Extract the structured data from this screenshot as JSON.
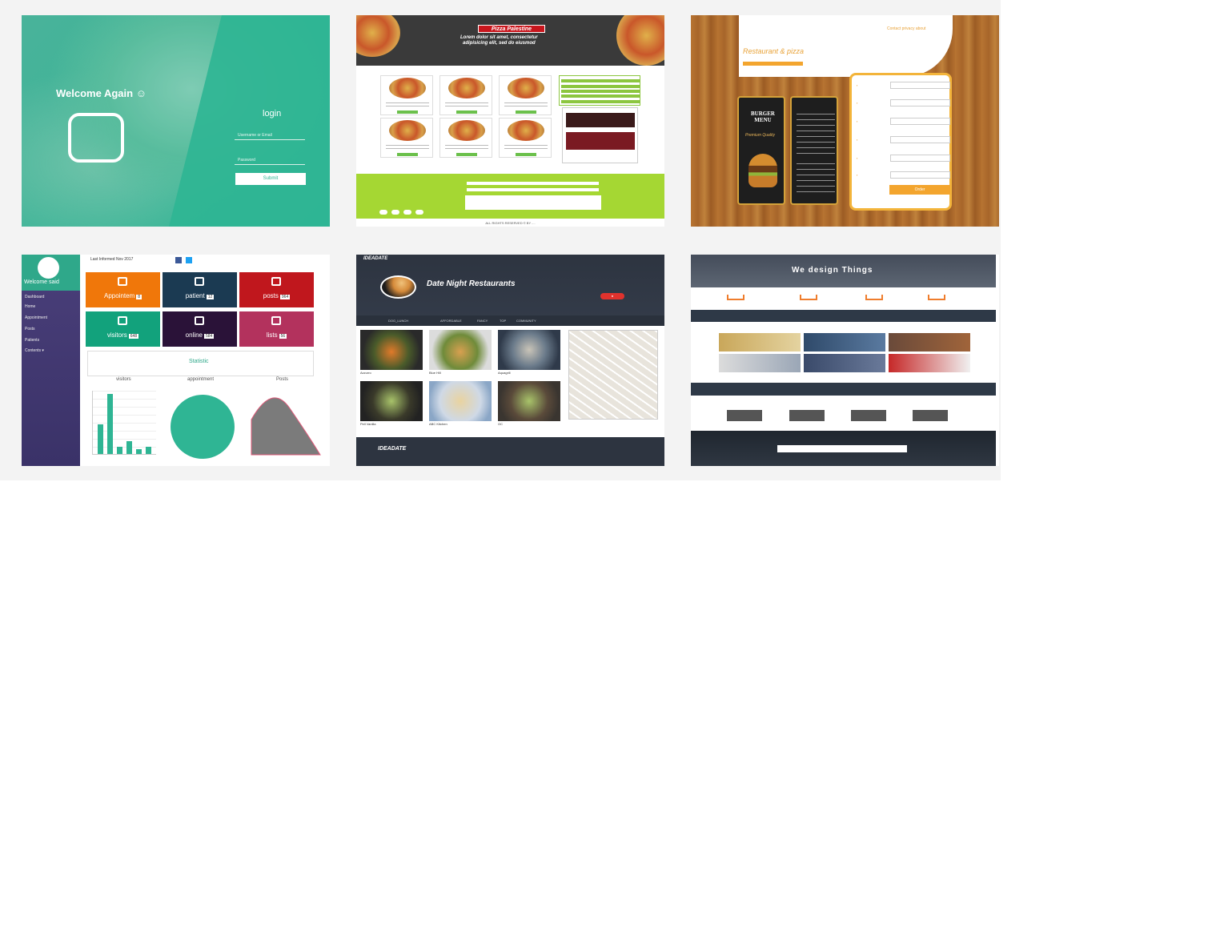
{
  "tile1": {
    "welcome": "Welcome Again ☺",
    "login_title": "login",
    "username_placeholder": "Username or Email",
    "password_placeholder": "Password",
    "submit_label": "Submit"
  },
  "tile2": {
    "title": "Pizza Palestine",
    "subtitle_line1": "Lorem dolor sit amet, consectetur",
    "subtitle_line2": "adipisicing elit, sed do eiusmod",
    "copyright": "ALL RIGHTS RESERVED © BY ...."
  },
  "tile3": {
    "brand": "Restaurant & pizza",
    "nav": "Contact   privacy   about",
    "menu_title": "BURGER MENU",
    "menu_subtitle": "Premium Quality",
    "order_label": "Order"
  },
  "tile4": {
    "welcome": "Welcome said",
    "date_text": "Last Informed Nov 2017",
    "sidebar": [
      "Dashboard",
      "Home",
      "Appointment",
      "Posts",
      "Patients",
      "Contents ▾"
    ],
    "cards": [
      {
        "label": "Appointem",
        "count": "8",
        "color": "#f0770a"
      },
      {
        "label": "patient",
        "count": "12",
        "color": "#1b3a52"
      },
      {
        "label": "posts",
        "count": "964",
        "color": "#c0171d"
      },
      {
        "label": "visitors",
        "count": "648",
        "color": "#12a27c"
      },
      {
        "label": "online",
        "count": "584",
        "color": "#2a1238"
      },
      {
        "label": "lists",
        "count": "56",
        "color": "#b3325d"
      }
    ],
    "statistic_label": "Statistic",
    "chart_titles": [
      "visitors",
      "appointment",
      "Posts"
    ],
    "bar_values": [
      12,
      24,
      3,
      5,
      2,
      3
    ]
  },
  "tile5": {
    "logo": "IDEADATE",
    "title": "Date Night Restaurants",
    "tabs": [
      "DOG_LUNCH",
      "AFFORDABLE",
      "FANCY",
      "TOP",
      "COMMUNITY"
    ],
    "foods": [
      "Azzurro",
      "Blue Hill",
      "Aquagrill",
      "Pell Vanilla",
      "ABC Kitchen",
      "OC"
    ],
    "footer_logo": "IDEADATE"
  },
  "tile6": {
    "hero": "We design Things"
  }
}
